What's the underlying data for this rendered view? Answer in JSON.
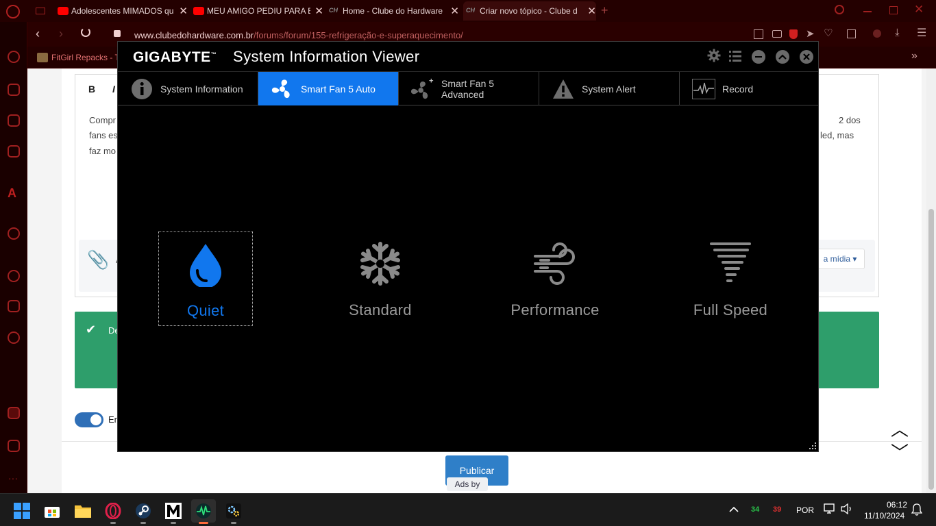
{
  "browser": {
    "tabs": [
      {
        "label": "Adolescentes MIMADOS qu",
        "icon": "youtube-icon"
      },
      {
        "label": "MEU AMIGO PEDIU PARA E",
        "icon": "youtube-icon"
      },
      {
        "label": "Home - Clube do Hardware",
        "icon": "cdh-icon"
      },
      {
        "label": "Criar novo tópico - Clube d",
        "icon": "cdh-icon",
        "active": true
      }
    ],
    "url_host": "www.clubedohardware.com.br",
    "url_path": "/forums/forum/155-refrigeração-e-superaquecimento/",
    "bookmark": "FitGirl Repacks - T"
  },
  "webpage": {
    "editor_bold": "B",
    "editor_italic": "I",
    "text_line1_start": "Compr",
    "text_line1_end": "2 dos",
    "text_line2_start": "fans es",
    "text_line2_end": "led, mas",
    "text_line3_start": "faz mo",
    "attach_fragment": "A",
    "media_button": "a mídia ▾",
    "green_fragment": "De",
    "toggle_label": "En",
    "publish_button": "Publicar",
    "ads_label": "Ads by"
  },
  "app": {
    "brand": "GIGABYTE",
    "brand_tm": "™",
    "title": "System Information Viewer",
    "tabs": [
      {
        "label": "System Information",
        "icon": "info-icon"
      },
      {
        "label": "Smart Fan 5 Auto",
        "icon": "fan-icon",
        "active": true
      },
      {
        "label": "Smart Fan 5 Advanced",
        "icon": "fan-plus-icon"
      },
      {
        "label": "System Alert",
        "icon": "warning-icon"
      },
      {
        "label": "Record",
        "icon": "pulse-icon"
      }
    ],
    "modes": [
      {
        "label": "Quiet",
        "icon": "droplet-icon",
        "selected": true
      },
      {
        "label": "Standard",
        "icon": "snowflake-icon"
      },
      {
        "label": "Performance",
        "icon": "wind-icon"
      },
      {
        "label": "Full Speed",
        "icon": "tornado-icon"
      }
    ],
    "accent_color": "#1177ee"
  },
  "taskbar": {
    "apps": [
      "windows-start-icon",
      "store-icon",
      "file-explorer-icon",
      "opera-gx-icon",
      "steam-icon",
      "m-app-icon",
      "siv-monitor-icon",
      "gear-app-icon"
    ],
    "temp_green": "34",
    "temp_red": "39",
    "language": "POR",
    "time": "06:12",
    "date": "11/10/2024"
  }
}
